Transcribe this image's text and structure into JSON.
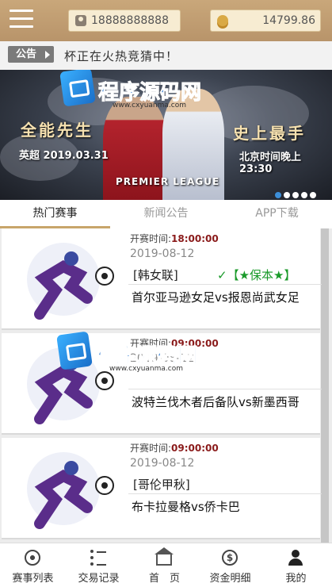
{
  "header": {
    "username": "18888888888",
    "balance": "14799.86",
    "menu_icon": "menu-icon",
    "user_icon": "user-icon",
    "coin_icon": "coin-icon"
  },
  "notice": {
    "tag": "公告",
    "text": "杯正在火热竞猜中！"
  },
  "banner": {
    "left_title": "全能先生",
    "left_date": "英超 2019.03.31",
    "right_title": "史上最手",
    "right_time": "北京时间晚上23:30",
    "league_text": "PREMIER LEAGUE",
    "slide_count": 5,
    "active_slide": 0
  },
  "watermark": {
    "text_main": "程序",
    "text_accent": "源码网",
    "site": "www.cxyuanma.com"
  },
  "tabs": [
    {
      "label": "热门赛事"
    },
    {
      "label": "新闻公告"
    },
    {
      "label": "APP下载"
    }
  ],
  "matches": [
    {
      "time_label": "开赛时间:",
      "time": "18:00:00",
      "date": "2019-08-12",
      "league": "[韩女联]",
      "tip": "✓【★保本★】",
      "teams": "首尔亚马逊女足vs报恩尚武女足"
    },
    {
      "time_label": "开赛时间:",
      "time": "09:00:00",
      "date": "2019-08-12",
      "league": "",
      "tip": "",
      "teams": "波特兰伐木者后备队vs新墨西哥"
    },
    {
      "time_label": "开赛时间:",
      "time": "09:00:00",
      "date": "2019-08-12",
      "league": "[哥伦甲秋]",
      "tip": "",
      "teams": "布卡拉曼格vs侨卡巴"
    }
  ],
  "bottom_nav": [
    {
      "label": "赛事列表",
      "icon": "soccer-ball-icon"
    },
    {
      "label": "交易记录",
      "icon": "list-icon"
    },
    {
      "label": "首　页",
      "icon": "home-icon"
    },
    {
      "label": "资金明细",
      "icon": "dollar-icon"
    },
    {
      "label": "我的",
      "icon": "user-icon"
    }
  ],
  "colors": {
    "header": "#c0a070",
    "accent": "#c8a56a",
    "time": "#8a1a1a",
    "tip": "#1a9a2a"
  }
}
